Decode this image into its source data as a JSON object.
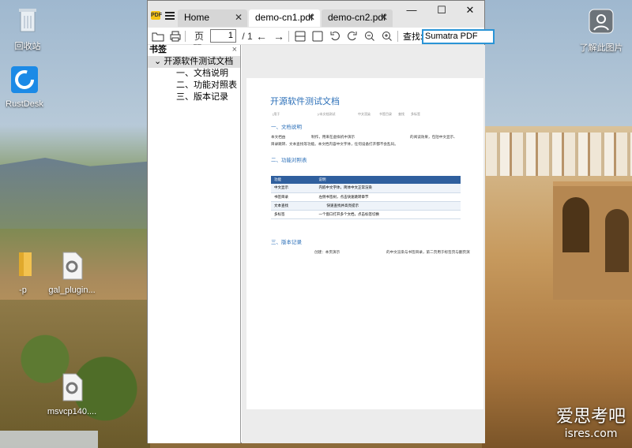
{
  "desktop": {
    "icons": [
      {
        "label": "回收站",
        "icon": "recycle-bin-icon"
      },
      {
        "label": "RustDesk",
        "icon": "rustdesk-icon"
      },
      {
        "label": "-p",
        "icon": "folder-icon"
      },
      {
        "label": "gal_plugin...",
        "icon": "gear-file-icon"
      },
      {
        "label": "msvcp140....",
        "icon": "gear-file-icon"
      },
      {
        "label": "了解此图片",
        "icon": "camera-icon"
      }
    ],
    "watermark": {
      "line1": "爱思考吧",
      "line2": "isres.com"
    }
  },
  "window": {
    "tabs": [
      {
        "label": "Home"
      },
      {
        "label": "demo-cn1.pdf"
      },
      {
        "label": "demo-cn2.pdf"
      }
    ],
    "controls": {
      "minimize": "—",
      "maximize": "☐",
      "close": "✕"
    },
    "toolbar": {
      "page_label": "页码:",
      "page_value": "1",
      "page_total": "/ 1",
      "find_label": "查找:",
      "find_value": "Sumatra PDF"
    },
    "sidebar": {
      "title": "书签",
      "close": "×",
      "root": "开源软件测试文档",
      "items": [
        "一、文档说明",
        "二、功能对照表",
        "三、版本记录"
      ]
    }
  },
  "document": {
    "title": "开源软件测试文档",
    "meta": [
      "(用于",
      ")/本文档测试",
      "中文渲染",
      "书签目录",
      "查找",
      "多标签"
    ],
    "s1_title": "一、文档说明",
    "s1_line1a": "本文档由",
    "s1_line1b": "制作，用来在虚拟机中演示",
    "s1_line1c": "的阅读效果，包括中文显示、",
    "s1_line2": "目录跳转、文本查找等功能。本文档内容中文字体，任何设备打开都不会乱码。",
    "s2_title": "二、功能对照表",
    "table": {
      "headers": [
        "功能",
        "说明"
      ],
      "rows": [
        [
          "中文显示",
          "内嵌中文字体，简体中文正常渲染"
        ],
        [
          "书签目录",
          "左侧书签树，点击快速跳转章节"
        ],
        [
          "文本查找",
          "快速查找并高亮提示"
        ],
        [
          "多标签",
          "一个窗口打开多个文档，点击标签切换"
        ]
      ]
    },
    "s3_title": "三、版本记录",
    "s3_line_a": "创建：本页演示",
    "s3_line_b": "的中文渲染与书签目录，第二页用于标签页与翻页演"
  }
}
